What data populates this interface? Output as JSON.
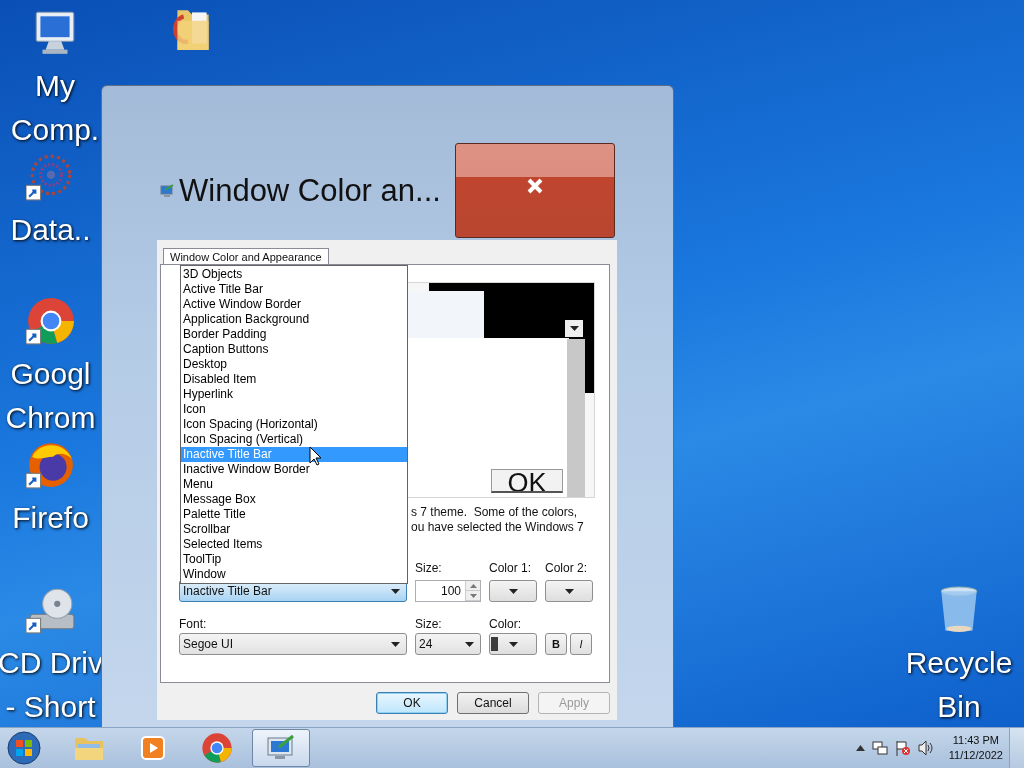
{
  "desktop_icons": [
    {
      "kind": "computer",
      "shortcut": false,
      "label": [
        "My",
        "Comp."
      ]
    },
    {
      "kind": "folder",
      "shortcut": false
    },
    {
      "kind": "network",
      "shortcut": true,
      "label": [
        "Data.."
      ]
    },
    {
      "kind": "chrome",
      "shortcut": true,
      "label": [
        "Googl",
        "Chrom"
      ]
    },
    {
      "kind": "firefox",
      "shortcut": true,
      "label": [
        "Firefo"
      ]
    },
    {
      "kind": "cd-drive",
      "shortcut": true,
      "label": [
        "CD Driv",
        "- Short"
      ]
    },
    {
      "kind": "recycle-bin",
      "shortcut": false,
      "label": [
        "Recycle",
        "Bin"
      ]
    }
  ],
  "window": {
    "title": "Window Color an..."
  },
  "tab": {
    "label": "Window Color and Appearance",
    "selected": true
  },
  "preview": {
    "button": "OK"
  },
  "description": [
    "s 7 theme.  Some of the colors,",
    "ou have selected the Windows 7"
  ],
  "item": {
    "value": "Inactive Title Bar",
    "focused": true,
    "open": true,
    "options": [
      {
        "label": "3D Objects",
        "selected": false
      },
      {
        "label": "Active Title Bar",
        "selected": false
      },
      {
        "label": "Active Window Border",
        "selected": false
      },
      {
        "label": "Application Background",
        "selected": false
      },
      {
        "label": "Border Padding",
        "selected": false
      },
      {
        "label": "Caption Buttons",
        "selected": false
      },
      {
        "label": "Desktop",
        "selected": false
      },
      {
        "label": "Disabled Item",
        "selected": false
      },
      {
        "label": "Hyperlink",
        "selected": false
      },
      {
        "label": "Icon",
        "selected": false
      },
      {
        "label": "Icon Spacing (Horizontal)",
        "selected": false
      },
      {
        "label": "Icon Spacing (Vertical)",
        "selected": false
      },
      {
        "label": "Inactive Title Bar",
        "selected": true
      },
      {
        "label": "Inactive Window Border",
        "selected": false
      },
      {
        "label": "Menu",
        "selected": false
      },
      {
        "label": "Message Box",
        "selected": false
      },
      {
        "label": "Palette Title",
        "selected": false
      },
      {
        "label": "Scrollbar",
        "selected": false
      },
      {
        "label": "Selected Items",
        "selected": false
      },
      {
        "label": "ToolTip",
        "selected": false
      },
      {
        "label": "Window",
        "selected": false
      }
    ]
  },
  "item_size": {
    "label": "Size:",
    "value": "100"
  },
  "color1": {
    "label": "Color 1:"
  },
  "color2": {
    "label": "Color 2:"
  },
  "font": {
    "label": "Font:",
    "value": "Segoe UI"
  },
  "font_size": {
    "label": "Size:",
    "value": "24"
  },
  "font_color": {
    "label": "Color:"
  },
  "bold": {
    "label": "B"
  },
  "italic": {
    "label": "I"
  },
  "buttons": [
    {
      "label": "OK",
      "default": true,
      "disabled": false
    },
    {
      "label": "Cancel",
      "default": false,
      "disabled": false
    },
    {
      "label": "Apply",
      "default": false,
      "disabled": true
    }
  ],
  "taskbar": {
    "items": [
      {
        "kind": "explorer",
        "active": false
      },
      {
        "kind": "media-player",
        "active": false
      },
      {
        "kind": "chrome",
        "active": false
      },
      {
        "kind": "display",
        "active": true
      }
    ],
    "clock": {
      "time": "11:43 PM",
      "date": "11/12/2022"
    }
  }
}
